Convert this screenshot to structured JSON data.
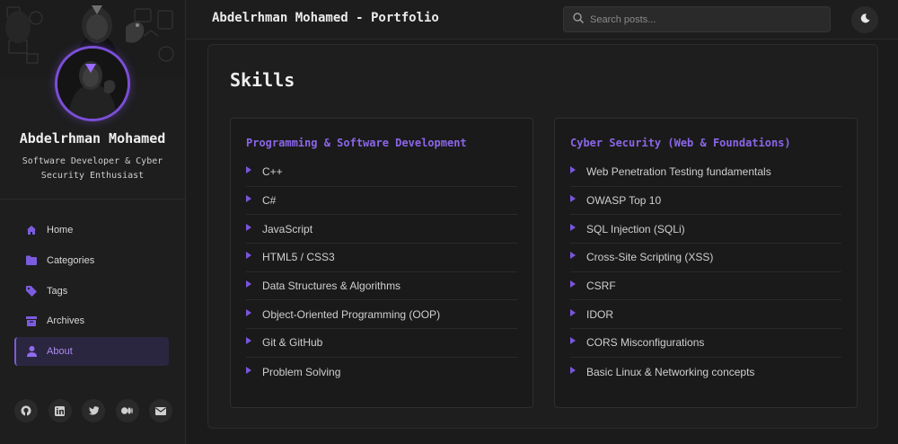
{
  "header": {
    "site_title": "Abdelrhman Mohamed - Portfolio",
    "search_placeholder": "Search posts...",
    "theme_icon": "moon-icon"
  },
  "profile": {
    "name": "Abdelrhman Mohamed",
    "bio": "Software Developer & Cyber Security Enthusiast"
  },
  "nav": {
    "items": [
      {
        "label": "Home",
        "icon": "home-icon",
        "active": false
      },
      {
        "label": "Categories",
        "icon": "folder-icon",
        "active": false
      },
      {
        "label": "Tags",
        "icon": "tag-icon",
        "active": false
      },
      {
        "label": "Archives",
        "icon": "archive-icon",
        "active": false
      },
      {
        "label": "About",
        "icon": "user-icon",
        "active": true
      }
    ]
  },
  "socials": [
    "github-icon",
    "linkedin-icon",
    "twitter-icon",
    "medium-icon",
    "email-icon"
  ],
  "main": {
    "title": "Skills",
    "panels": [
      {
        "title": "Programming & Software Development",
        "items": [
          "C++",
          "C#",
          "JavaScript",
          "HTML5 / CSS3",
          "Data Structures & Algorithms",
          "Object-Oriented Programming (OOP)",
          "Git & GitHub",
          "Problem Solving"
        ]
      },
      {
        "title": "Cyber Security (Web & Foundations)",
        "items": [
          "Web Penetration Testing fundamentals",
          "OWASP Top 10",
          "SQL Injection (SQLi)",
          "Cross-Site Scripting (XSS)",
          "CSRF",
          "IDOR",
          "CORS Misconfigurations",
          "Basic Linux & Networking concepts"
        ]
      }
    ]
  },
  "colors": {
    "accent": "#7b4fd6",
    "background": "#1b1b1b",
    "panel_title": "#8b66e8"
  }
}
